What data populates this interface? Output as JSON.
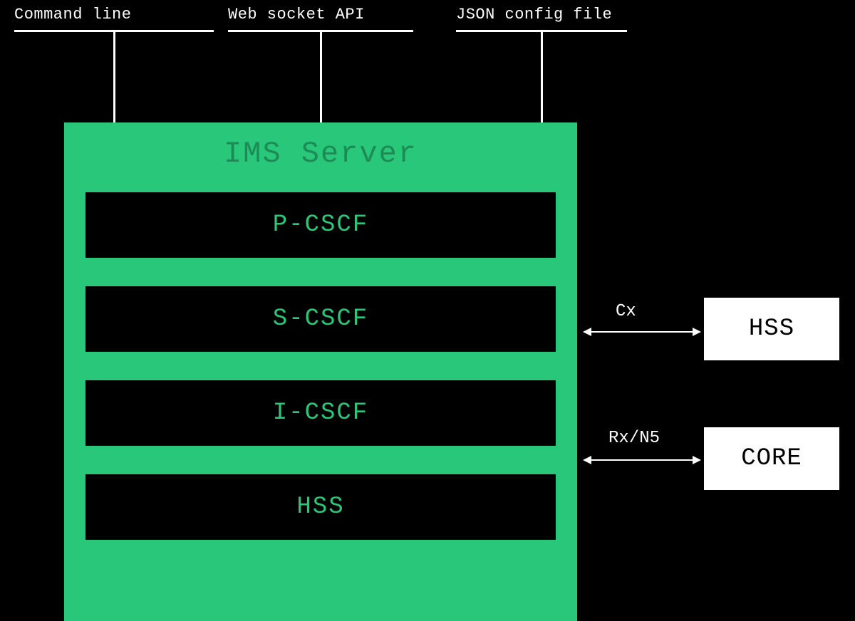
{
  "top_interfaces": {
    "command_line": {
      "label": "Command line"
    },
    "web_socket_api": {
      "label": "Web socket API"
    },
    "json_config": {
      "label": "JSON config file"
    }
  },
  "server": {
    "title": "IMS Server",
    "modules": {
      "p_cscf": {
        "label": "P-CSCF"
      },
      "s_cscf": {
        "label": "S-CSCF"
      },
      "i_cscf": {
        "label": "I-CSCF"
      },
      "hss": {
        "label": "HSS"
      }
    }
  },
  "external": {
    "hss": {
      "label": "HSS"
    },
    "core": {
      "label": "CORE"
    }
  },
  "links": {
    "cx": {
      "label": "Cx"
    },
    "rx_n5": {
      "label": "Rx/N5"
    }
  },
  "colors": {
    "background": "#000000",
    "server_box": "#29c77a",
    "module_bg": "#000000",
    "module_fg": "#29c77a",
    "external_bg": "#ffffff",
    "external_fg": "#000000",
    "line": "#ffffff"
  }
}
